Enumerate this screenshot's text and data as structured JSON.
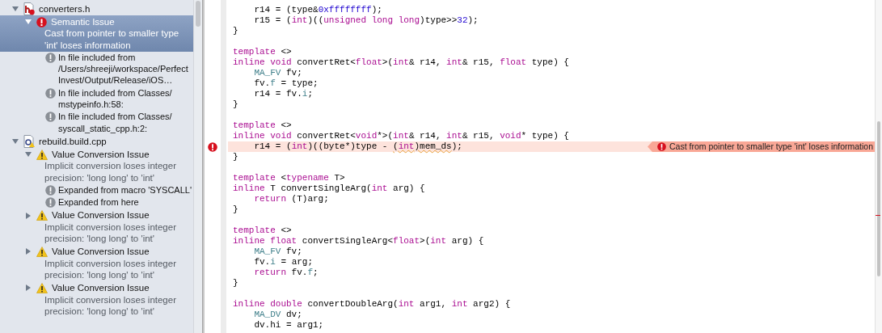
{
  "navigator": {
    "files": [
      {
        "kind": "header",
        "name": "converters.h",
        "expanded": true,
        "issues": [
          {
            "kind": "error",
            "title": "Semantic Issue",
            "message": "Cast from pointer to smaller type 'int' loses information",
            "expanded": true,
            "selected": true,
            "notes": [
              {
                "kind": "note",
                "text": "In file included from /Users/shreeji/workspace/Perfect Invest/Output/Release/iOS…"
              },
              {
                "kind": "note",
                "text": "In file included from Classes/ mstypeinfo.h:58:"
              },
              {
                "kind": "note",
                "text": "In file included from Classes/ syscall_static_cpp.h:2:"
              }
            ]
          }
        ]
      },
      {
        "kind": "source",
        "name": "rebuild.build.cpp",
        "expanded": true,
        "issues": [
          {
            "kind": "warning",
            "title": "Value Conversion Issue",
            "message": "Implicit conversion loses integer precision: 'long long' to 'int'",
            "expanded": true,
            "selected": false,
            "notes": [
              {
                "kind": "note",
                "text": "Expanded from macro 'SYSCALL'"
              },
              {
                "kind": "note",
                "text": "Expanded from here"
              }
            ]
          },
          {
            "kind": "warning",
            "title": "Value Conversion Issue",
            "message": "Implicit conversion loses integer precision: 'long long' to 'int'",
            "expanded": false,
            "selected": false
          },
          {
            "kind": "warning",
            "title": "Value Conversion Issue",
            "message": "Implicit conversion loses integer precision: 'long long' to 'int'",
            "expanded": false,
            "selected": false
          },
          {
            "kind": "warning",
            "title": "Value Conversion Issue",
            "message": "Implicit conversion loses integer precision: 'long long' to 'int'",
            "expanded": false,
            "selected": false
          }
        ]
      }
    ]
  },
  "editor": {
    "lines": [
      {
        "kind": "code",
        "tokens": [
          {
            "kind": "plain",
            "t": "    r14 = (type&"
          },
          {
            "kind": "num",
            "t": "0xffffffff"
          },
          {
            "kind": "plain",
            "t": ");"
          }
        ]
      },
      {
        "kind": "code",
        "tokens": [
          {
            "kind": "plain",
            "t": "    r15 = ("
          },
          {
            "kind": "kw",
            "t": "int"
          },
          {
            "kind": "plain",
            "t": ")(("
          },
          {
            "kind": "kw",
            "t": "unsigned long long"
          },
          {
            "kind": "plain",
            "t": ")type>>"
          },
          {
            "kind": "num",
            "t": "32"
          },
          {
            "kind": "plain",
            "t": ");"
          }
        ]
      },
      {
        "kind": "code",
        "tokens": [
          {
            "kind": "plain",
            "t": "}"
          }
        ]
      },
      {
        "kind": "blank"
      },
      {
        "kind": "code",
        "tokens": [
          {
            "kind": "kw",
            "t": "template"
          },
          {
            "kind": "plain",
            "t": " <>"
          }
        ]
      },
      {
        "kind": "code",
        "tokens": [
          {
            "kind": "kw",
            "t": "inline void"
          },
          {
            "kind": "plain",
            "t": " convertRet<"
          },
          {
            "kind": "kw",
            "t": "float"
          },
          {
            "kind": "plain",
            "t": ">("
          },
          {
            "kind": "kw",
            "t": "int"
          },
          {
            "kind": "plain",
            "t": "& r14, "
          },
          {
            "kind": "kw",
            "t": "int"
          },
          {
            "kind": "plain",
            "t": "& r15, "
          },
          {
            "kind": "kw",
            "t": "float"
          },
          {
            "kind": "plain",
            "t": " type) {"
          }
        ]
      },
      {
        "kind": "code",
        "tokens": [
          {
            "kind": "type",
            "t": "    MA_FV"
          },
          {
            "kind": "plain",
            "t": " fv;"
          }
        ]
      },
      {
        "kind": "code",
        "tokens": [
          {
            "kind": "plain",
            "t": "    fv."
          },
          {
            "kind": "member",
            "t": "f"
          },
          {
            "kind": "plain",
            "t": " = type;"
          }
        ]
      },
      {
        "kind": "code",
        "tokens": [
          {
            "kind": "plain",
            "t": "    r14 = fv."
          },
          {
            "kind": "member",
            "t": "i"
          },
          {
            "kind": "plain",
            "t": ";"
          }
        ]
      },
      {
        "kind": "code",
        "tokens": [
          {
            "kind": "plain",
            "t": "}"
          }
        ]
      },
      {
        "kind": "blank"
      },
      {
        "kind": "code",
        "tokens": [
          {
            "kind": "kw",
            "t": "template"
          },
          {
            "kind": "plain",
            "t": " <>"
          }
        ]
      },
      {
        "kind": "code",
        "tokens": [
          {
            "kind": "kw",
            "t": "inline void"
          },
          {
            "kind": "plain",
            "t": " convertRet<"
          },
          {
            "kind": "kw",
            "t": "void"
          },
          {
            "kind": "plain",
            "t": "*>("
          },
          {
            "kind": "kw",
            "t": "int"
          },
          {
            "kind": "plain",
            "t": "& r14, "
          },
          {
            "kind": "kw",
            "t": "int"
          },
          {
            "kind": "plain",
            "t": "& r15, "
          },
          {
            "kind": "kw",
            "t": "void"
          },
          {
            "kind": "plain",
            "t": "* type) {"
          }
        ]
      },
      {
        "kind": "code",
        "tokens": [
          {
            "kind": "plain",
            "t": "    r14 = ("
          },
          {
            "kind": "kw",
            "t": "int"
          },
          {
            "kind": "plain",
            "t": ")((byte*)type - "
          },
          {
            "kind": "plain",
            "t": "(",
            "underlined": true
          },
          {
            "kind": "kw",
            "t": "int",
            "underlined": true
          },
          {
            "kind": "plain",
            "t": ")mem_ds",
            "underlined": true
          },
          {
            "kind": "plain",
            "t": ");"
          }
        ],
        "error": true,
        "annotation": {
          "kind": "error",
          "text": "Cast from pointer to smaller type 'int' loses information"
        }
      },
      {
        "kind": "code",
        "tokens": [
          {
            "kind": "plain",
            "t": "}"
          }
        ]
      },
      {
        "kind": "blank"
      },
      {
        "kind": "code",
        "tokens": [
          {
            "kind": "kw",
            "t": "template"
          },
          {
            "kind": "plain",
            "t": " <"
          },
          {
            "kind": "kw",
            "t": "typename"
          },
          {
            "kind": "plain",
            "t": " T>"
          }
        ]
      },
      {
        "kind": "code",
        "tokens": [
          {
            "kind": "kw",
            "t": "inline"
          },
          {
            "kind": "plain",
            "t": " T convertSingleArg("
          },
          {
            "kind": "kw",
            "t": "int"
          },
          {
            "kind": "plain",
            "t": " arg) {"
          }
        ]
      },
      {
        "kind": "code",
        "tokens": [
          {
            "kind": "kw",
            "t": "    return"
          },
          {
            "kind": "plain",
            "t": " (T)arg;"
          }
        ]
      },
      {
        "kind": "code",
        "tokens": [
          {
            "kind": "plain",
            "t": "}"
          }
        ]
      },
      {
        "kind": "blank"
      },
      {
        "kind": "code",
        "tokens": [
          {
            "kind": "kw",
            "t": "template"
          },
          {
            "kind": "plain",
            "t": " <>"
          }
        ]
      },
      {
        "kind": "code",
        "tokens": [
          {
            "kind": "kw",
            "t": "inline float"
          },
          {
            "kind": "plain",
            "t": " convertSingleArg<"
          },
          {
            "kind": "kw",
            "t": "float"
          },
          {
            "kind": "plain",
            "t": ">("
          },
          {
            "kind": "kw",
            "t": "int"
          },
          {
            "kind": "plain",
            "t": " arg) {"
          }
        ]
      },
      {
        "kind": "code",
        "tokens": [
          {
            "kind": "type",
            "t": "    MA_FV"
          },
          {
            "kind": "plain",
            "t": " fv;"
          }
        ]
      },
      {
        "kind": "code",
        "tokens": [
          {
            "kind": "plain",
            "t": "    fv."
          },
          {
            "kind": "member",
            "t": "i"
          },
          {
            "kind": "plain",
            "t": " = arg;"
          }
        ]
      },
      {
        "kind": "code",
        "tokens": [
          {
            "kind": "kw",
            "t": "    return"
          },
          {
            "kind": "plain",
            "t": " fv."
          },
          {
            "kind": "member",
            "t": "f"
          },
          {
            "kind": "plain",
            "t": ";"
          }
        ]
      },
      {
        "kind": "code",
        "tokens": [
          {
            "kind": "plain",
            "t": "}"
          }
        ]
      },
      {
        "kind": "blank"
      },
      {
        "kind": "code",
        "tokens": [
          {
            "kind": "kw",
            "t": "inline double"
          },
          {
            "kind": "plain",
            "t": " convertDoubleArg("
          },
          {
            "kind": "kw",
            "t": "int"
          },
          {
            "kind": "plain",
            "t": " arg1, "
          },
          {
            "kind": "kw",
            "t": "int"
          },
          {
            "kind": "plain",
            "t": " arg2) {"
          }
        ]
      },
      {
        "kind": "code",
        "tokens": [
          {
            "kind": "type",
            "t": "    MA_DV"
          },
          {
            "kind": "plain",
            "t": " dv;"
          }
        ]
      },
      {
        "kind": "code",
        "tokens": [
          {
            "kind": "plain",
            "t": "    dv.hi = arg1;"
          }
        ]
      }
    ]
  }
}
